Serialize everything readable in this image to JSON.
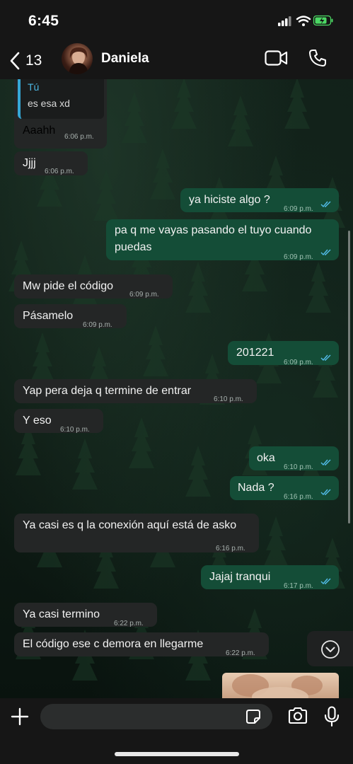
{
  "status_bar": {
    "time": "6:45",
    "battery_color": "#4cd964"
  },
  "header": {
    "back_count": "13",
    "contact_name": "Daniela"
  },
  "reply_preview": {
    "author": "Tú",
    "text": "es esa xd"
  },
  "messages": [
    {
      "direction": "in",
      "text": "Aaahh",
      "time": "6:06 p.m."
    },
    {
      "direction": "in",
      "text": "Jjjj",
      "time": "6:06 p.m."
    },
    {
      "direction": "out",
      "text": "ya hiciste algo ?",
      "time": "6:09 p.m.",
      "read": true
    },
    {
      "direction": "out",
      "text": "pa q me vayas pasando el tuyo cuando puedas",
      "time": "6:09 p.m.",
      "read": true
    },
    {
      "direction": "in",
      "text": "Mw pide el código",
      "time": "6:09 p.m."
    },
    {
      "direction": "in",
      "text": "Pásamelo",
      "time": "6:09 p.m."
    },
    {
      "direction": "out",
      "text": "201221",
      "time": "6:09 p.m.",
      "read": true
    },
    {
      "direction": "in",
      "text": "Yap pera deja q termine de entrar",
      "time": "6:10 p.m."
    },
    {
      "direction": "in",
      "text": "Y eso",
      "time": "6:10 p.m."
    },
    {
      "direction": "out",
      "text": "oka",
      "time": "6:10 p.m.",
      "read": true
    },
    {
      "direction": "out",
      "text": "Nada ?",
      "time": "6:16 p.m.",
      "read": true
    },
    {
      "direction": "in",
      "text": "Ya casi es q la conexión aquí está de asko",
      "time": "6:16 p.m."
    },
    {
      "direction": "out",
      "text": "Jajaj tranqui",
      "time": "6:17 p.m.",
      "read": true
    },
    {
      "direction": "in",
      "text": "Ya casi termino",
      "time": "6:22 p.m."
    },
    {
      "direction": "in",
      "text": "El código ese c demora en llegarme",
      "time": "6:22 p.m."
    }
  ],
  "input": {
    "placeholder": ""
  },
  "colors": {
    "incoming_bubble": "#242626",
    "outgoing_bubble": "#144d37",
    "read_ticks": "#53bdeb",
    "reply_accent": "#35a8d6"
  },
  "icons": [
    "back-chevron-icon",
    "video-call-icon",
    "phone-icon",
    "plus-icon",
    "sticker-icon",
    "camera-icon",
    "microphone-icon",
    "scroll-down-chevron-icon"
  ]
}
